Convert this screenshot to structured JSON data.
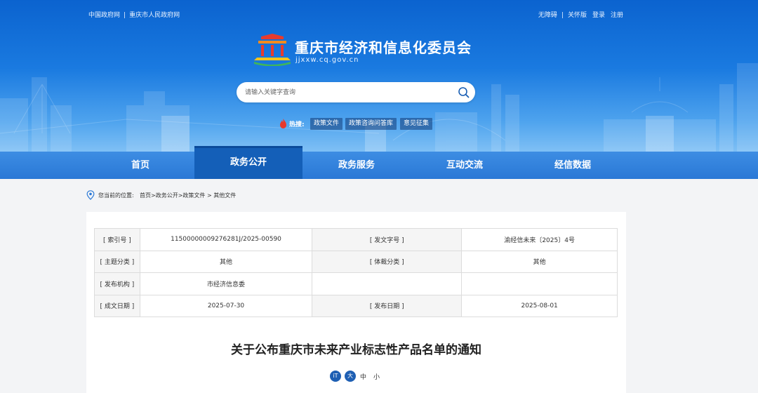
{
  "topbar": {
    "links_left": [
      "中国政府网",
      "重庆市人民政府网"
    ],
    "separator": "|",
    "links_right": [
      "无障碍",
      "关怀版",
      "登录",
      "注册"
    ]
  },
  "site": {
    "title": "重庆市经济和信息化委员会",
    "domain": "jjxxw.cq.gov.cn"
  },
  "search": {
    "placeholder": "请输入关键字查询"
  },
  "hot": {
    "label": "热搜:",
    "tags": [
      "政策文件",
      "政策咨询问答库",
      "意见征集"
    ]
  },
  "nav": {
    "items": [
      "首页",
      "政务公开",
      "政务服务",
      "互动交流",
      "经信数据"
    ],
    "active_index": 1
  },
  "breadcrumb": {
    "label": "您当前的位置:",
    "path": "首页>政务公开>政策文件 > 其他文件"
  },
  "meta_table": [
    [
      "[ 索引号 ]",
      "11500000009276281J/2025-00590",
      "[ 发文字号 ]",
      "渝经信未来〔2025〕4号"
    ],
    [
      "[ 主题分类 ]",
      "其他",
      "[ 体裁分类 ]",
      "其他"
    ],
    [
      "[ 发布机构 ]",
      "市经济信息委",
      "",
      ""
    ],
    [
      "[ 成文日期 ]",
      "2025-07-30",
      "[ 发布日期 ]",
      "2025-08-01"
    ]
  ],
  "document": {
    "title": "关于公布重庆市未来产业标志性产品名单的通知"
  },
  "font_tools": {
    "icon_label": "iT",
    "large": "大",
    "medium": "中",
    "small": "小"
  },
  "colors": {
    "nav_active": "#145fb8",
    "nav_bg": "#2a78d6",
    "banner_top": "#0b63cf"
  }
}
